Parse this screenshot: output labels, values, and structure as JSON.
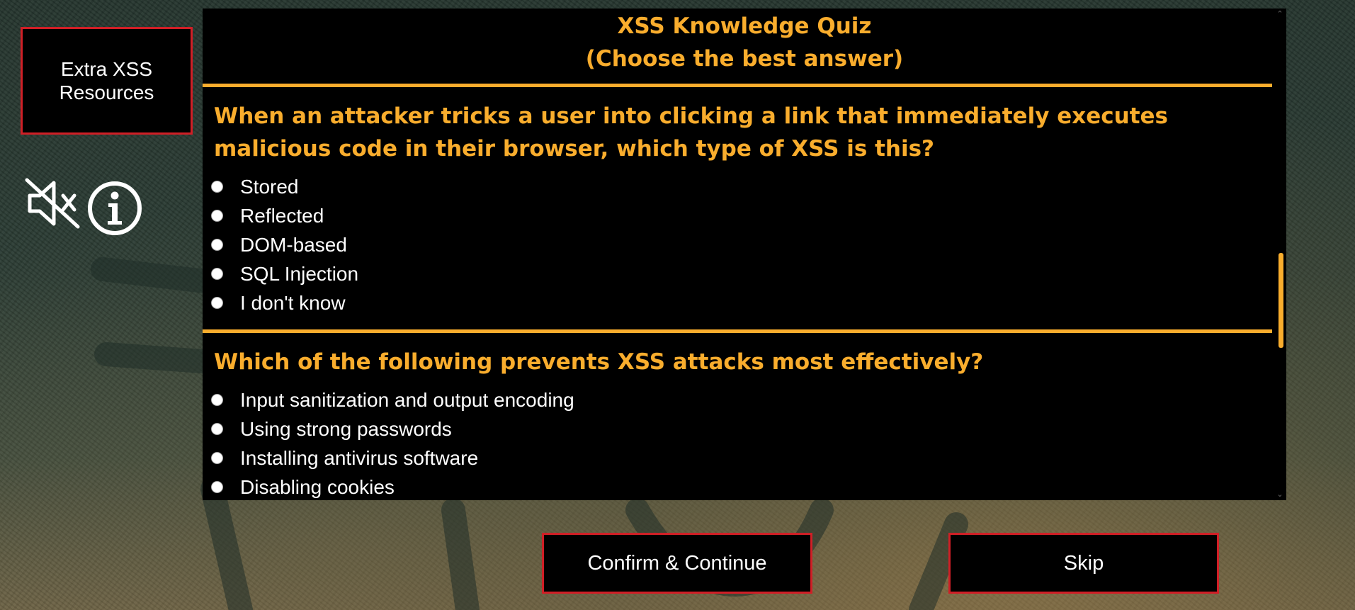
{
  "sidebar": {
    "resources_label": "Extra XSS Resources",
    "mute_icon": "speaker-muted-icon",
    "info_icon": "info-circle-icon"
  },
  "quiz": {
    "title": "XSS Knowledge Quiz",
    "subtitle": "(Choose the best answer)",
    "questions": [
      {
        "text": "When an attacker tricks a user into clicking a link that immediately executes malicious code in their browser, which type of XSS is this?",
        "options": [
          "Stored",
          "Reflected",
          "DOM-based",
          "SQL Injection",
          "I don't know"
        ]
      },
      {
        "text": "Which of the following prevents XSS attacks most effectively?",
        "options": [
          "Input sanitization and output encoding",
          "Using strong passwords",
          "Installing antivirus software",
          "Disabling cookies"
        ]
      }
    ]
  },
  "actions": {
    "confirm_label": "Confirm & Continue",
    "skip_label": "Skip"
  },
  "colors": {
    "accent": "#f9ad2d",
    "button_border": "#d01f26",
    "panel_bg": "#000000"
  }
}
